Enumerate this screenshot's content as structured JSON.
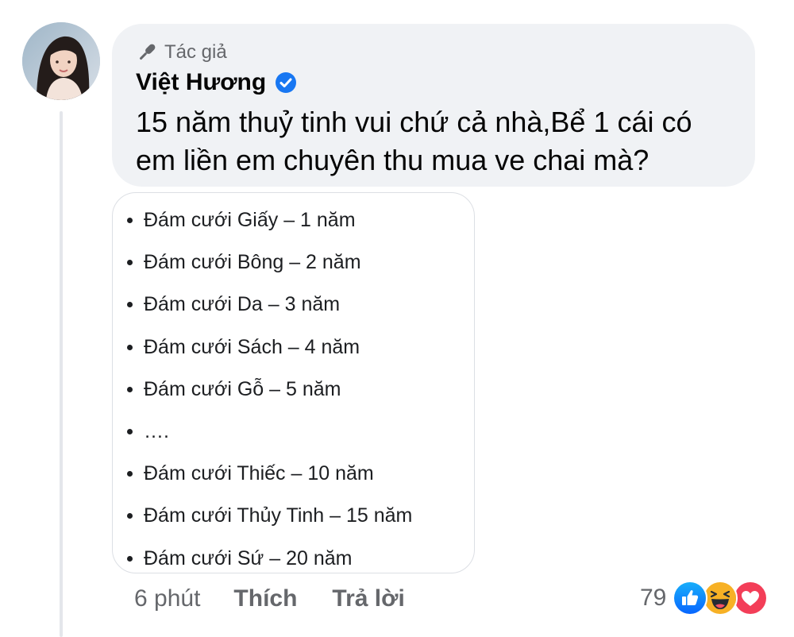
{
  "author_tag": "Tác giả",
  "author_name": "Việt Hương",
  "comment_text": "15 năm thuỷ tinh vui chứ cả nhà,Bể 1 cái có em liền em chuyên thu mua ve chai mà?",
  "attachment": {
    "items": [
      "Đám cưới Giấy – 1 năm",
      "Đám cưới Bông – 2 năm",
      "Đám cưới Da – 3 năm",
      "Đám cưới Sách – 4 năm",
      "Đám cưới Gỗ – 5 năm",
      "….",
      "Đám cưới Thiếc – 10 năm",
      "Đám cưới Thủy Tinh – 15 năm",
      "Đám cưới Sứ – 20 năm"
    ]
  },
  "actions": {
    "time": "6 phút",
    "like_label": "Thích",
    "reply_label": "Trả lời"
  },
  "reactions": {
    "count": "79",
    "icons": [
      "like-icon",
      "haha-icon",
      "love-icon"
    ]
  },
  "colors": {
    "bubble_bg": "#f0f2f5",
    "verified_blue": "#1877f2",
    "love_red": "#f33e58",
    "haha_yellow": "#f7b125",
    "secondary_text": "#65676b"
  }
}
